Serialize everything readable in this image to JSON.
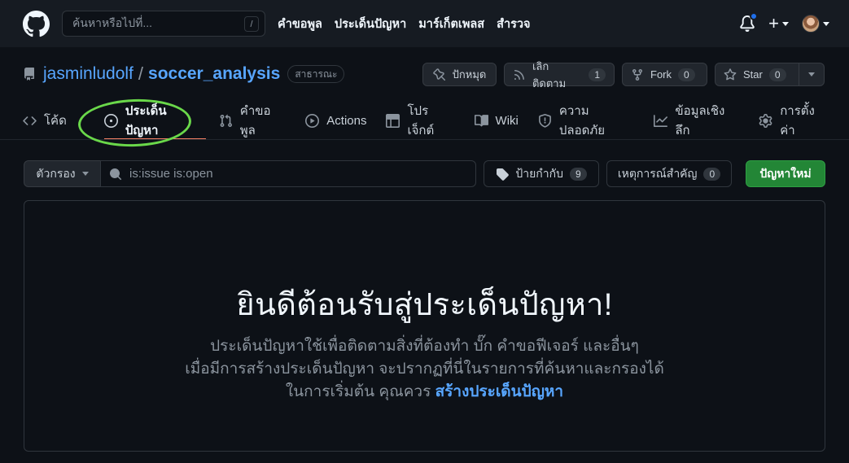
{
  "header": {
    "search_placeholder": "ค้นหาหรือไปที่...",
    "search_shortcut": "/",
    "nav": [
      "คำขอพูล",
      "ประเด็นปัญหา",
      "มาร์เก็ตเพลส",
      "สำรวจ"
    ]
  },
  "repo": {
    "owner": "jasminludolf",
    "separator": "/",
    "name": "soccer_analysis",
    "visibility": "สาธารณะ",
    "pin_label": "ปักหมุด",
    "unwatch_label": "เลิกติดตาม",
    "watch_count": "1",
    "fork_label": "Fork",
    "fork_count": "0",
    "star_label": "Star",
    "star_count": "0"
  },
  "tabs": {
    "code": "โค้ด",
    "issues": "ประเด็นปัญหา",
    "pulls": "คำขอพูล",
    "actions": "Actions",
    "projects": "โปรเจ็กต์",
    "wiki": "Wiki",
    "security": "ความปลอดภัย",
    "insights": "ข้อมูลเชิงลึก",
    "settings": "การตั้งค่า"
  },
  "filters": {
    "filter_label": "ตัวกรอง",
    "query": "is:issue is:open",
    "labels_label": "ป้ายกำกับ",
    "labels_count": "9",
    "milestones_label": "เหตุการณ์สำคัญ",
    "milestones_count": "0",
    "new_issue_label": "ปัญหาใหม่"
  },
  "blankslate": {
    "title": "ยินดีต้อนรับสู่ประเด็นปัญหา!",
    "line1": "ประเด็นปัญหาใช้เพื่อติดตามสิ่งที่ต้องทำ บั๊ก คำขอฟีเจอร์ และอื่นๆ",
    "line2": "เมื่อมีการสร้างประเด็นปัญหา จะปรากฏที่นี่ในรายการที่ค้นหาและกรองได้",
    "line3_prefix": "ในการเริ่มต้น คุณควร",
    "line3_link": "สร้างประเด็นปัญหา"
  },
  "colors": {
    "background": "#0d1117",
    "header": "#161b22",
    "link": "#58a6ff",
    "primary_button": "#238636",
    "active_tab_underline": "#f78166",
    "annotation_circle": "#6ad84a"
  }
}
